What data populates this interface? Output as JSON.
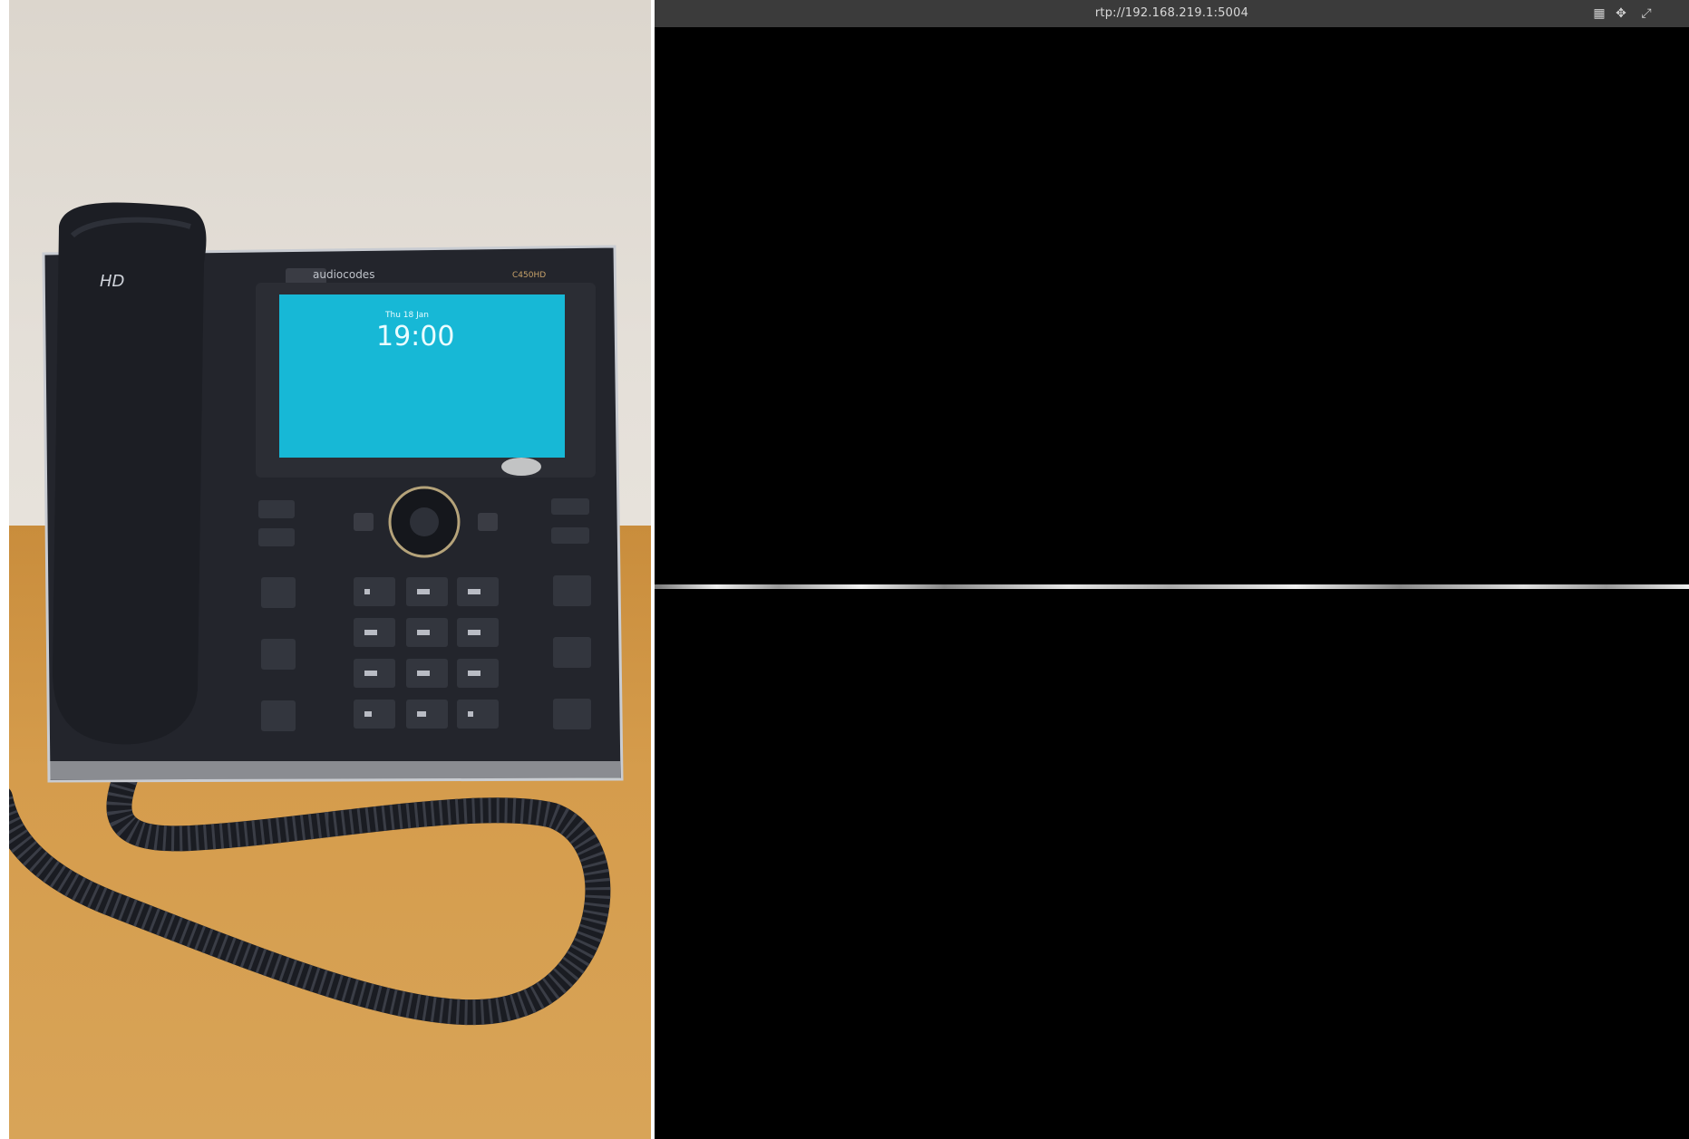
{
  "stream": {
    "url": "rtp://192.168.219.1:5004",
    "icons": [
      "grid-icon",
      "move-icon",
      "expand-icon"
    ]
  },
  "phone": {
    "brand": "audiocodes",
    "handset_logo": "HD",
    "model": "C450HD",
    "lcd_time": "19:00",
    "lcd_date": "Thu  18  Jan"
  },
  "colors": {
    "lcd": "#17b8d6",
    "toolbar": "#3b3b3b",
    "stream_bg": "#000000"
  }
}
